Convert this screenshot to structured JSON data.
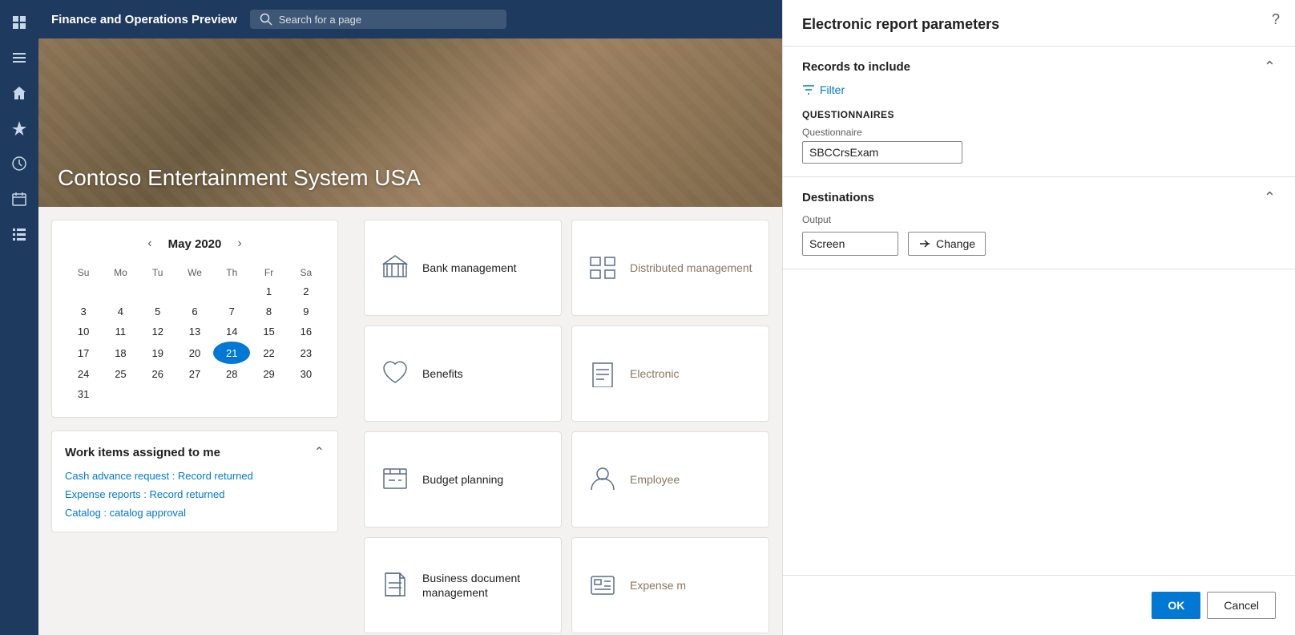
{
  "app": {
    "title": "Finance and Operations Preview",
    "search_placeholder": "Search for a page"
  },
  "banner": {
    "company_name": "Contoso Entertainment System USA"
  },
  "nav": {
    "icons": [
      "grid",
      "home",
      "star",
      "clock",
      "calendar",
      "list"
    ]
  },
  "calendar": {
    "month": "May",
    "year": "2020",
    "day_headers": [
      "Su",
      "Mo",
      "Tu",
      "We",
      "Th",
      "Fr",
      "Sa"
    ],
    "today": 21,
    "weeks": [
      [
        "",
        "",
        "",
        "",
        "",
        "1",
        "2"
      ],
      [
        "3",
        "4",
        "5",
        "6",
        "7",
        "8",
        "9"
      ],
      [
        "10",
        "11",
        "12",
        "13",
        "14",
        "15",
        "16"
      ],
      [
        "17",
        "18",
        "19",
        "20",
        "21",
        "22",
        "23"
      ],
      [
        "24",
        "25",
        "26",
        "27",
        "28",
        "29",
        "30"
      ],
      [
        "31",
        "",
        "",
        "",
        "",
        "",
        ""
      ]
    ]
  },
  "work_items": {
    "title": "Work items assigned to me",
    "items": [
      "Cash advance request : Record returned",
      "Expense reports : Record returned",
      "Catalog : catalog approval"
    ]
  },
  "tiles": [
    {
      "label": "Bank management",
      "icon": "bank"
    },
    {
      "label": "Distributed management",
      "icon": "distribute",
      "partial": true
    },
    {
      "label": "Benefits",
      "icon": "benefits"
    },
    {
      "label": "Electronic",
      "icon": "electronic",
      "partial": true
    },
    {
      "label": "Budget planning",
      "icon": "budget"
    },
    {
      "label": "Employee",
      "icon": "employee",
      "partial": true
    },
    {
      "label": "Business document management",
      "icon": "document"
    },
    {
      "label": "Expense m",
      "icon": "expense",
      "partial": true
    }
  ],
  "panel": {
    "title": "Electronic report parameters",
    "records_section": {
      "title": "Records to include",
      "filter_label": "Filter",
      "questionnaires_label": "QUESTIONNAIRES",
      "questionnaire_field_label": "Questionnaire",
      "questionnaire_value": "SBCCrsExam"
    },
    "destinations_section": {
      "title": "Destinations",
      "output_label": "Output",
      "output_value": "Screen",
      "change_label": "Change"
    },
    "ok_label": "OK",
    "cancel_label": "Cancel"
  },
  "help": {
    "icon_label": "?"
  }
}
